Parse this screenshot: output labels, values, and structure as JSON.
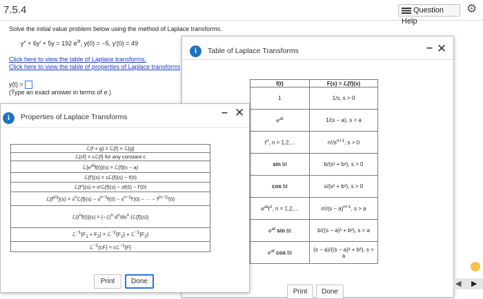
{
  "header": {
    "section": "7.5.4",
    "help_label": "Question Help"
  },
  "question": {
    "instructions": "Solve the initial value problem below using the method of Laplace transforms.",
    "equation": "y'' + 6y' + 5y = 192 e^3t, y(0) = −5, y'(0) = 49",
    "link_table": "Click here to view the table of Laplace transforms.",
    "link_properties": "Click here to view the table of properties of Laplace transforms.",
    "answer_prompt": "y(t) =",
    "hint": "(Type an exact answer in terms of e.)"
  },
  "laplace_panel": {
    "title": "Table of Laplace Transforms",
    "headers": [
      "f(t)",
      "F(s) = ℒ{f}(s)"
    ],
    "rows": [
      {
        "f": "1",
        "F": "1/s, s > 0"
      },
      {
        "f": "e^at",
        "F": "1/(s − a), s > a"
      },
      {
        "f": "t^n, n = 1,2,...",
        "F": "n!/s^(n+1), s > 0"
      },
      {
        "f": "sin bt",
        "F": "b/(s² + b²), s > 0"
      },
      {
        "f": "cos bt",
        "F": "s/(s² + b²), s > 0"
      },
      {
        "f": "e^at t^n, n = 1,2,...",
        "F": "n!/(s − a)^(n+1), s > a"
      },
      {
        "f": "e^at sin bt",
        "F": "b/((s − a)² + b²), s > a"
      },
      {
        "f": "e^at cos bt",
        "F": "(s − a)/((s − a)² + b²), s > a"
      }
    ],
    "print_label": "Print",
    "done_label": "Done"
  },
  "properties_panel": {
    "title": "Properties of Laplace Transforms",
    "rows": [
      "ℒ{f + g} = ℒ{f} + ℒ{g}",
      "ℒ{cf} = cℒ{f} for any constant c",
      "ℒ{e^at f(t)}(s) = ℒ{f}(s − a)",
      "ℒ{f'}(s) = sℒ{f}(s) − f(0)",
      "ℒ{f''}(s) = s²ℒ{f}(s) − sf(0) − f'(0)",
      "ℒ{f^(n)}(s) = s^n ℒ{f}(s) − s^(n−1) f(0) − s^(n−2) f'(0) − ··· − f^(n−1)(0)",
      "ℒ{t^n f(t)}(s) = (−1)^n d^n/ds^n (ℒ{f}(s))",
      "ℒ^−1{F1 + F2} = ℒ^−1{F1} + ℒ^−1{F2}",
      "ℒ^−1{cF} = cℒ^−1{F}"
    ],
    "print_label": "Print",
    "done_label": "Done"
  }
}
